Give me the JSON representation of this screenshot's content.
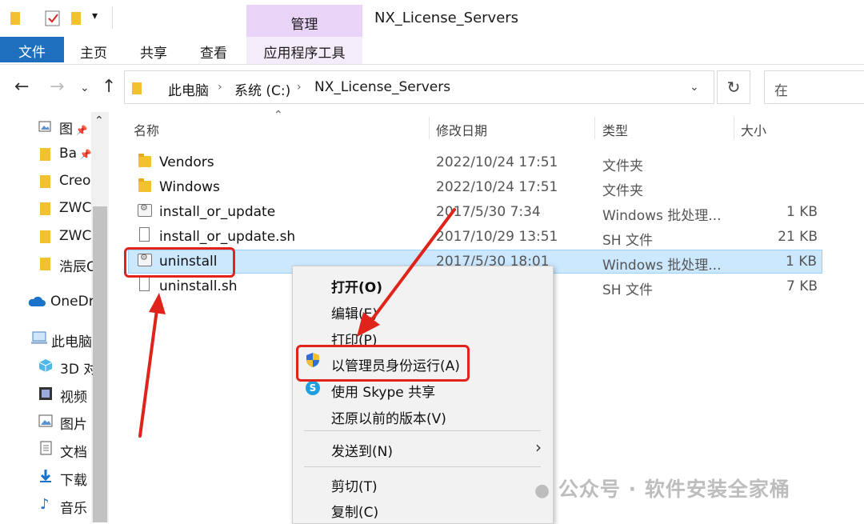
{
  "window": {
    "title": "NX_License_Servers",
    "manage_tab": "管理"
  },
  "ribbon": {
    "tabs": [
      "文件",
      "主页",
      "共享",
      "查看",
      "应用程序工具"
    ]
  },
  "address": {
    "segments": [
      "此电脑",
      "系统 (C:)",
      "NX_License_Servers"
    ],
    "search_placeholder": "在"
  },
  "nav_pane": {
    "items": [
      {
        "label": "图",
        "icon": "picture-icon"
      },
      {
        "label": "Ba",
        "icon": "folder-icon"
      },
      {
        "label": "Creo",
        "icon": "folder-icon"
      },
      {
        "label": "ZWC",
        "icon": "folder-icon"
      },
      {
        "label": "ZWC",
        "icon": "folder-icon"
      },
      {
        "label": "浩辰C",
        "icon": "folder-icon"
      },
      {
        "label": "OneDr",
        "icon": "cloud-icon"
      },
      {
        "label": "此电脑",
        "icon": "computer-icon"
      },
      {
        "label": "3D 对",
        "icon": "3d-objects-icon"
      },
      {
        "label": "视频",
        "icon": "video-icon"
      },
      {
        "label": "图片",
        "icon": "picture-icon"
      },
      {
        "label": "文档",
        "icon": "document-icon"
      },
      {
        "label": "下载",
        "icon": "download-icon"
      },
      {
        "label": "音乐",
        "icon": "music-icon"
      }
    ]
  },
  "columns": {
    "name": "名称",
    "date": "修改日期",
    "type": "类型",
    "size": "大小"
  },
  "files": [
    {
      "name": "Vendors",
      "date": "2022/10/24 17:51",
      "type": "文件夹",
      "size": "",
      "icon": "folder-icon"
    },
    {
      "name": "Windows",
      "date": "2022/10/24 17:51",
      "type": "文件夹",
      "size": "",
      "icon": "folder-icon"
    },
    {
      "name": "install_or_update",
      "date": "2017/5/30 7:34",
      "type": "Windows 批处理...",
      "size": "1 KB",
      "icon": "batch-file-icon"
    },
    {
      "name": "install_or_update.sh",
      "date": "2017/10/29 13:51",
      "type": "SH 文件",
      "size": "21 KB",
      "icon": "file-icon"
    },
    {
      "name": "uninstall",
      "date": "2017/5/30 18:01",
      "type": "Windows 批处理...",
      "size": "1 KB",
      "icon": "batch-file-icon",
      "selected": true
    },
    {
      "name": "uninstall.sh",
      "date": "",
      "type": "SH 文件",
      "size": "7 KB",
      "icon": "file-icon"
    }
  ],
  "context_menu": {
    "open": "打开(O)",
    "edit": "编辑(E)",
    "print": "打印(P)",
    "run_as_admin": "以管理员身份运行(A)",
    "skype_share": "使用 Skype 共享",
    "restore_versions": "还原以前的版本(V)",
    "send_to": "发送到(N)",
    "cut": "剪切(T)",
    "copy": "复制(C)"
  },
  "watermark": "公众号 · 软件安装全家桶",
  "colors": {
    "accent": "#1f6fbf",
    "selection": "#cce8ff",
    "manage_tab": "#e9d3f7",
    "annotation": "#e0241c"
  }
}
